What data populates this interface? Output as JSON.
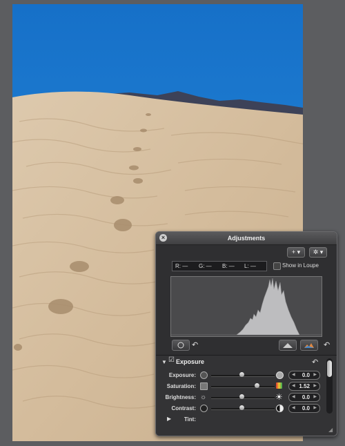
{
  "panel": {
    "title": "Adjustments",
    "add_label": "+ ▾",
    "action_label": "✲ ▾",
    "readout": {
      "r": "R: —",
      "g": "G: —",
      "b": "B: —",
      "l": "L: —"
    },
    "show_in_loupe": "Show in Loupe",
    "show_in_loupe_checked": false
  },
  "exposure_section": {
    "title": "Exposure",
    "enabled": true,
    "rows": [
      {
        "label": "Exposure:",
        "value": "0.0",
        "slider": 0.5
      },
      {
        "label": "Saturation:",
        "value": "1.52",
        "slider": 0.76
      },
      {
        "label": "Brightness:",
        "value": "0.0",
        "slider": 0.5
      },
      {
        "label": "Contrast:",
        "value": "0.0",
        "slider": 0.5
      }
    ],
    "tint_label": "Tint:"
  },
  "colors": {
    "sky": "#1e7fd0",
    "sand": "#d8c4a8",
    "panel": "#2f2f31"
  }
}
